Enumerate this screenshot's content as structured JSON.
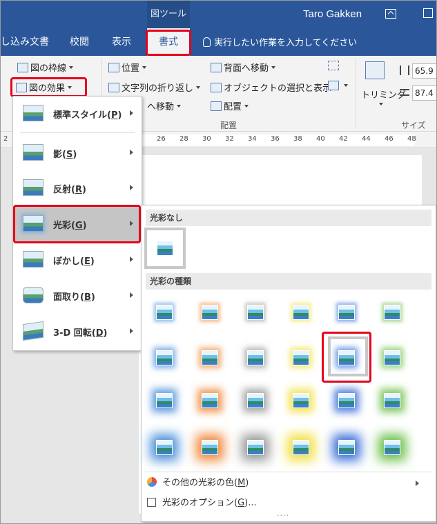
{
  "titlebar": {
    "context_tab": "図ツール",
    "user": "Taro Gakken",
    "colors": {
      "bar": "#2b579a",
      "highlight": "#e6001a"
    }
  },
  "tabs": [
    {
      "label": "し込み文書"
    },
    {
      "label": "校閲"
    },
    {
      "label": "表示"
    }
  ],
  "active_tab": "書式",
  "tell_me": "実行したい作業を入力してください",
  "ribbon": {
    "picture_border": "図の枠線",
    "picture_effects": "図の効果",
    "position": "位置",
    "wrap_text": "文字列の折り返し",
    "bring_forward_partial": "へ移動",
    "send_backward": "背面へ移動",
    "selection_pane": "オブジェクトの選択と表示",
    "align": "配置",
    "arrange_group": "配置",
    "crop": "トリミング",
    "height": "65.9",
    "width": "87.4",
    "size_group": "サイズ"
  },
  "ruler": [
    "2",
    "26",
    "28",
    "30",
    "32",
    "34",
    "36",
    "38",
    "40",
    "42",
    "44",
    "46",
    "48"
  ],
  "effects_menu": [
    {
      "label": "標準スタイル(",
      "key": "P",
      "selected": false
    },
    {
      "label": "影(",
      "key": "S",
      "selected": false
    },
    {
      "label": "反射(",
      "key": "R",
      "selected": false
    },
    {
      "label": "光彩(",
      "key": "G",
      "selected": true
    },
    {
      "label": "ぼかし(",
      "key": "E",
      "selected": false
    },
    {
      "label": "面取り(",
      "key": "B",
      "selected": false
    },
    {
      "label": "3-D 回転(",
      "key": "D",
      "selected": false
    }
  ],
  "glow_gallery": {
    "no_glow_header": "光彩なし",
    "variations_header": "光彩の種類",
    "glow_colors": [
      "#4a8fd8",
      "#f08a3c",
      "#9a9a9a",
      "#f2e040",
      "#3a6fd8",
      "#6cc04a"
    ],
    "rows": [
      {
        "size": 5,
        "opacity": 0.55
      },
      {
        "size": 8,
        "opacity": 0.7
      },
      {
        "size": 11,
        "opacity": 0.85
      },
      {
        "size": 16,
        "opacity": 1.0
      }
    ],
    "more_colors": "その他の光彩の色(",
    "more_colors_key": "M",
    "options": "光彩のオプション(",
    "options_key": "G",
    "grip": "...."
  }
}
